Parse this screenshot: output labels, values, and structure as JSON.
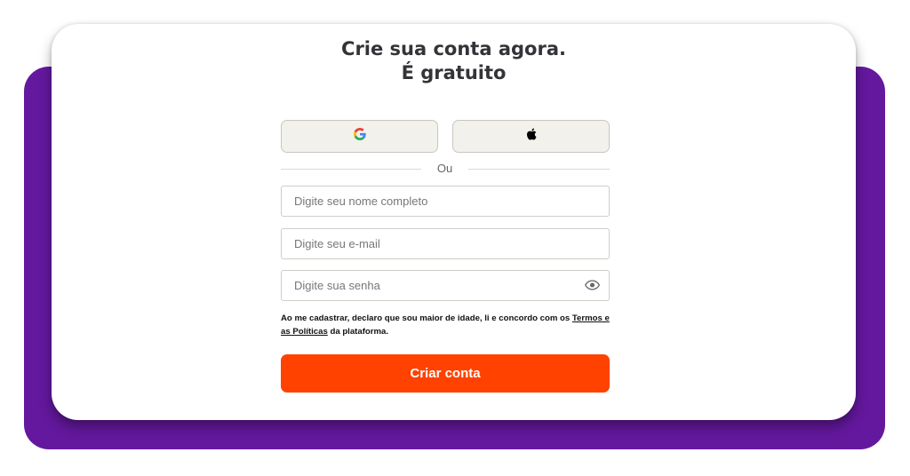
{
  "signup": {
    "title_line1": "Crie sua conta agora.",
    "title_line2": "É gratuito",
    "social": [
      {
        "provider": "google",
        "icon": "google-icon"
      },
      {
        "provider": "apple",
        "icon": "apple-icon"
      }
    ],
    "divider": "Ou",
    "fields": {
      "name_placeholder": "Digite seu nome completo",
      "email_placeholder": "Digite seu e-mail",
      "password_placeholder": "Digite sua senha"
    },
    "terms": {
      "prefix": "Ao me cadastrar, declaro que sou maior de idade, li e concordo com os ",
      "link": "Termos e as Políticas",
      "suffix": " da plataforma."
    },
    "submit_label": "Criar conta"
  },
  "colors": {
    "background_slab": "#64189e",
    "primary_button": "#ff4200",
    "social_button_bg": "#f3f1ec"
  }
}
